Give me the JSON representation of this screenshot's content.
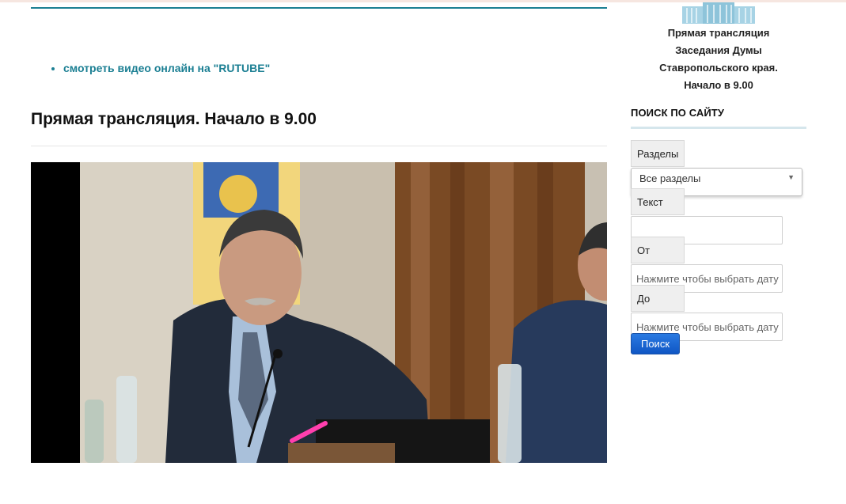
{
  "links": {
    "video_online": "смотреть видео онлайн на \"RUTUBE\""
  },
  "main": {
    "title": "Прямая трансляция. Начало в 9.00"
  },
  "sidebar": {
    "promo_lines": [
      "Прямая трансляция",
      "Заседания Думы",
      "Ставропольского края.",
      "Начало в 9.00"
    ],
    "search": {
      "heading": "ПОИСК ПО САЙТУ",
      "sections_label": "Разделы",
      "sections_selected": "Все разделы",
      "text_label": "Текст",
      "text_value": "",
      "from_label": "От",
      "from_placeholder": "Нажмите чтобы выбрать дату",
      "to_label": "До",
      "to_placeholder": "Нажмите чтобы выбрать дату",
      "submit_label": "Поиск"
    }
  },
  "colors": {
    "accent": "#1b7f93",
    "button": "#1566d0",
    "video_bg": "#000000"
  },
  "icons": {
    "select_arrow": "chevron-down-icon",
    "logo": "duma-building-logo"
  }
}
